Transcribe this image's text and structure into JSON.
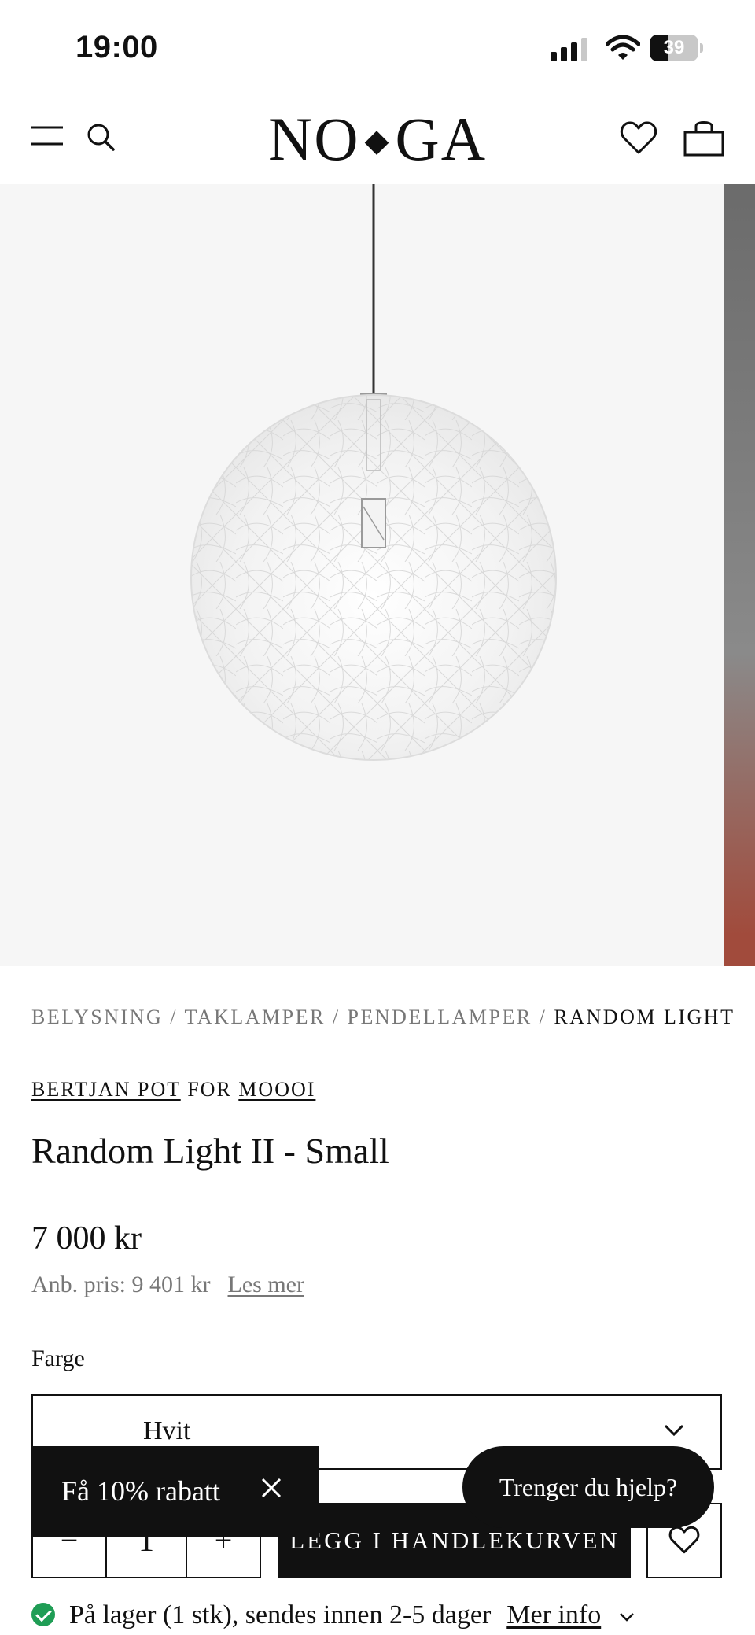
{
  "status_bar": {
    "time": "19:00",
    "battery": "39",
    "battery_level": 0.39
  },
  "header": {
    "logo_left": "NO",
    "logo_dot": "◆",
    "logo_right": "GA"
  },
  "breadcrumb": {
    "items": [
      "BELYSNING",
      "TAKLAMPER",
      "PENDELLAMPER"
    ],
    "separator": "/",
    "current": "RANDOM LIGHT"
  },
  "product": {
    "designer": "BERTJAN POT",
    "for_word": "FOR",
    "brand": "MOOOI",
    "title": "Random Light II - Small",
    "price": "7 000 kr",
    "recommended_price": "Anb. pris: 9 401 kr",
    "read_more": "Les mer",
    "color_label": "Farge",
    "color_value": "Hvit",
    "quantity": "1",
    "minus": "−",
    "plus": "+",
    "add_to_cart": "LEGG I HANDLEKURVEN",
    "stock_text": "På lager (1 stk), sendes innen 2-5 dager",
    "more_info": "Mer info"
  },
  "overlays": {
    "discount": "Få 10% rabatt",
    "help": "Trenger du hjelp?"
  },
  "colors": {
    "stock_check": "#1f9d55",
    "primary": "#111111",
    "image_bg": "#f6f6f6"
  }
}
